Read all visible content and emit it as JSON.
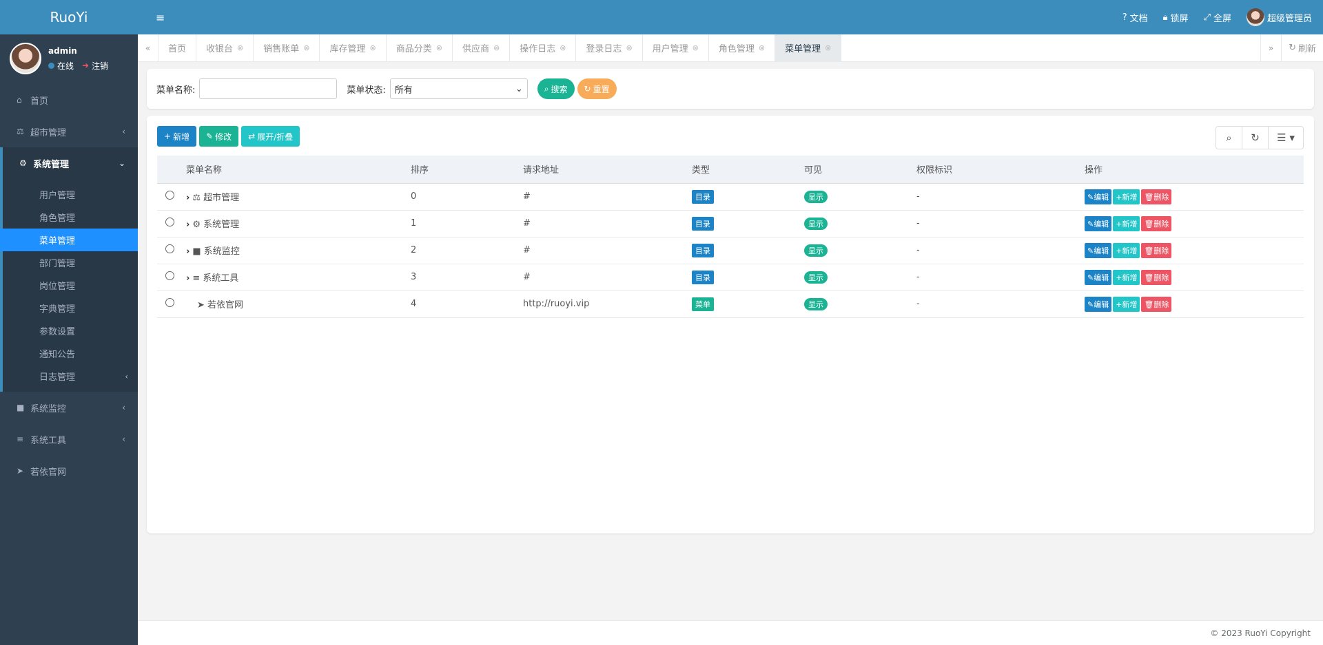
{
  "app": {
    "logo": "RuoYi"
  },
  "user": {
    "name": "admin",
    "status": "在线",
    "logout": "注销",
    "display_name": "超级管理员"
  },
  "header": {
    "docs": "文档",
    "lock": "锁屏",
    "fullscreen": "全屏"
  },
  "sidebar": {
    "home": "首页",
    "supermarket": "超市管理",
    "system": "系统管理",
    "sub": [
      "用户管理",
      "角色管理",
      "菜单管理",
      "部门管理",
      "岗位管理",
      "字典管理",
      "参数设置",
      "通知公告",
      "日志管理"
    ],
    "monitor": "系统监控",
    "tools": "系统工具",
    "website": "若依官网"
  },
  "tabs": [
    "首页",
    "收银台",
    "销售账单",
    "库存管理",
    "商品分类",
    "供应商",
    "操作日志",
    "登录日志",
    "用户管理",
    "角色管理",
    "菜单管理"
  ],
  "tab_refresh": "刷新",
  "search": {
    "name_label": "菜单名称:",
    "name_value": "",
    "status_label": "菜单状态:",
    "status_value": "所有",
    "search_btn": "搜索",
    "reset_btn": "重置"
  },
  "toolbar": {
    "add": "新增",
    "edit": "修改",
    "expand": "展开/折叠"
  },
  "table": {
    "headers": [
      "菜单名称",
      "排序",
      "请求地址",
      "类型",
      "可见",
      "权限标识",
      "操作"
    ],
    "rows": [
      {
        "name": "超市管理",
        "order": "0",
        "url": "#",
        "type": "目录",
        "visible": "显示",
        "perm": "-"
      },
      {
        "name": "系统管理",
        "order": "1",
        "url": "#",
        "type": "目录",
        "visible": "显示",
        "perm": "-"
      },
      {
        "name": "系统监控",
        "order": "2",
        "url": "#",
        "type": "目录",
        "visible": "显示",
        "perm": "-"
      },
      {
        "name": "系统工具",
        "order": "3",
        "url": "#",
        "type": "目录",
        "visible": "显示",
        "perm": "-"
      },
      {
        "name": "若依官网",
        "order": "4",
        "url": "http://ruoyi.vip",
        "type": "菜单",
        "visible": "显示",
        "perm": "-"
      }
    ],
    "actions": {
      "edit": "编辑",
      "add": "新增",
      "delete": "删除"
    }
  },
  "footer": "© 2023 RuoYi Copyright"
}
